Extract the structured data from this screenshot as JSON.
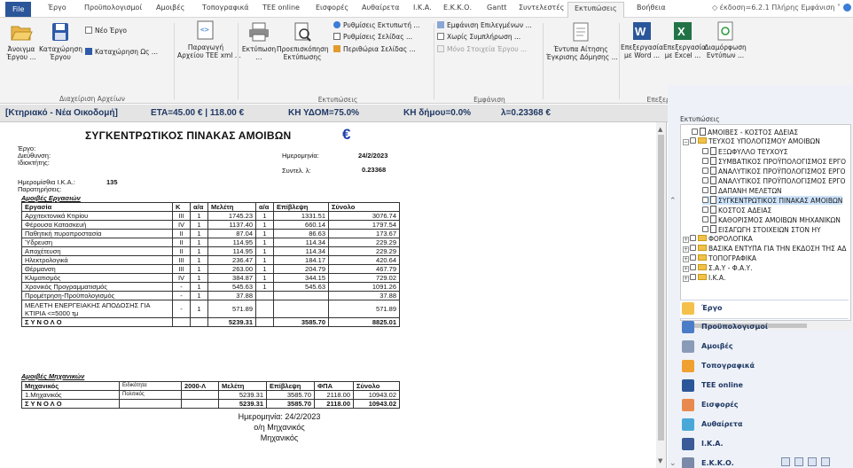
{
  "tabs": {
    "file": "File",
    "items": [
      "Έργο",
      "Προϋπολογισμοί",
      "Αμοιβές",
      "Τοπογραφικά",
      "TEE online",
      "Εισφορές",
      "Αυθαίρετα",
      "Ι.Κ.Α.",
      "Ε.Κ.Κ.Ο.",
      "Gantt",
      "Συντελεστές",
      "Εκτυπώσεις",
      "Βοήθεια"
    ],
    "active": "Εκτυπώσεις"
  },
  "version_info": "◇ έκδοση=6.2.1 Πλήρης  Εμφάνιση  ˅",
  "ribbon": {
    "archive": {
      "open": "Άνοιγμα\nΈργου ...",
      "save": "Καταχώρηση\nΈργου",
      "new": "Νέο Έργο",
      "save_as": "Καταχώρηση Ως ...",
      "group": "Διαχείριση Αρχείων"
    },
    "xml": {
      "label": "Παραγωγή\nΑρχείου TEE xml ..."
    },
    "print": {
      "print": "Εκτύπωση\n...",
      "preview": "Προεπισκόπηση\nΕκτύπωσης",
      "settings1": "Ρυθμίσεις Εκτυπωτή ...",
      "settings2": "Ρυθμίσεις Σελίδας ...",
      "margins": "Περιθώρια Σελίδας ...",
      "group": "Εκτυπώσεις"
    },
    "view": {
      "show_selected": "Εμφάνιση Επιλεγμένων ...",
      "no_fill": "Χωρίς Συμπλήρωση ...",
      "only_project": "Μόνο Στοιχεία Έργου ...",
      "group": "Εμφάνιση"
    },
    "permit": {
      "label": "Έντυπα Αίτησης\nΈγκρισης Δόμησης ..."
    },
    "word": {
      "label": "Επεξεργασία\nμε Word ..."
    },
    "excel": {
      "label": "Επεξεργασία\nμε Excel ..."
    },
    "format": {
      "label": "Διαμόρφωση\nΕντύπων ..."
    },
    "group_edit": "Επεξεργασία Εντύπων"
  },
  "infobar": {
    "project": "[Κτηριακό - Νέα Οικοδομή]",
    "eta": "ΕΤΑ=45.00 € | 118.00 €",
    "kh_ydom": "ΚΗ ΥΔΟΜ=75.0%",
    "kh_dimou": "ΚΗ δήμου=0.0%",
    "lambda": "λ=0.23368 €"
  },
  "doc": {
    "title": "ΣΥΓΚΕΝΤΡΩΤΙΚΟΣ ΠΙΝΑΚΑΣ ΑΜΟΙΒΩΝ",
    "euro": "€",
    "project_label": "Έργο:",
    "address_label": "Διεύθυνση:",
    "owner_label": "Ιδιοκτήτης:",
    "date_label": "Ημερομηνία:",
    "date_value": "24/2/2023",
    "coef_label": "Συντελ. λ:",
    "coef_value": "0.23368",
    "wage_label": "Ημερομίσθια Ι.Κ.Α.:",
    "wage_value": "135",
    "notes_label": "Παρατηρήσεις:",
    "works_title": "Αμοιβές Εργασιών",
    "works_headers": [
      "Εργασία",
      "Κ",
      "α/α",
      "Μελέτη",
      "α/α",
      "Επίβλεψη",
      "Σύνολο"
    ],
    "works_rows": [
      [
        "Αρχιτεκτονικά Κτιρίου",
        "III",
        "1",
        "1745.23",
        "1",
        "1331.51",
        "3076.74"
      ],
      [
        "Φέρουσα Κατασκευή",
        "IV",
        "1",
        "1137.40",
        "1",
        "660.14",
        "1797.54"
      ],
      [
        "Παθητική πυροπροστασία",
        "II",
        "1",
        "87.04",
        "1",
        "86.63",
        "173.67"
      ],
      [
        "Ύδρευση",
        "II",
        "1",
        "114.95",
        "1",
        "114.34",
        "229.29"
      ],
      [
        "Αποχέτευση",
        "II",
        "1",
        "114.95",
        "1",
        "114.34",
        "229.29"
      ],
      [
        "Ηλεκτρολογικά",
        "III",
        "1",
        "236.47",
        "1",
        "184.17",
        "420.64"
      ],
      [
        "Θέρμανση",
        "III",
        "1",
        "263.00",
        "1",
        "204.79",
        "467.79"
      ],
      [
        "Κλιματισμός",
        "IV",
        "1",
        "384.87",
        "1",
        "344.15",
        "729.02"
      ],
      [
        "Χρονικός Προγραμματισμός",
        "-",
        "1",
        "545.63",
        "1",
        "545.63",
        "1091.26"
      ],
      [
        "Προμέτρηση-Προϋπολογισμός",
        "-",
        "1",
        "37.88",
        "",
        "",
        "37.88"
      ],
      [
        "ΜΕΛΕΤΗ ΕΝΕΡΓΕΙΑΚΗΣ ΑΠΟΔΟΣΗΣ ΓΙΑ ΚΤΙΡΙΑ <=5000 τμ",
        "-",
        "1",
        "571.89",
        "",
        "",
        "571.89"
      ]
    ],
    "works_total": [
      "Σ Υ Ν Ο Λ Ο",
      "",
      "",
      "5239.31",
      "",
      "3585.70",
      "8825.01"
    ],
    "eng_title": "Αμοιβές Μηχανικών",
    "eng_headers": [
      "Μηχανικός",
      "Ειδικότητα",
      "2000-Λ",
      "Μελέτη",
      "Επίβλεψη",
      "ΦΠΑ",
      "Σύνολο"
    ],
    "eng_rows": [
      [
        "1.Μηχανικός",
        "Πολιτικός",
        "",
        "5239.31",
        "3585.70",
        "2118.00",
        "10943.02"
      ]
    ],
    "eng_total": [
      "Σ Υ Ν Ο Λ Ο",
      "",
      "",
      "5239.31",
      "3585.70",
      "2118.00",
      "10943.02"
    ],
    "sign_date": "Ημερομηνία: 24/2/2023",
    "sign_role": "ο/η Μηχανικός",
    "sign_name": "Μηχανικός"
  },
  "panel": {
    "header": "Εκτυπώσεις",
    "tree": [
      {
        "label": "ΑΜΟΙΒΕΣ - ΚΟΣΤΟΣ ΑΔΕΙΑΣ",
        "type": "page",
        "level": 1
      },
      {
        "label": "ΤΕΥΧΟΣ ΥΠΟΛΟΓΙΣΜΟΥ ΑΜΟΙΒΩΝ",
        "type": "folder-open",
        "level": 0
      },
      {
        "label": "ΕΞΩΦΥΛΛΟ ΤΕΥΧΟΥΣ",
        "type": "page",
        "level": 2
      },
      {
        "label": "ΣΥΜΒΑΤΙΚΟΣ ΠΡΟΫΠΟΛΟΓΙΣΜΟΣ ΕΡΓΟ",
        "type": "page",
        "level": 2
      },
      {
        "label": "ΑΝΑΛΥΤΙΚΟΣ ΠΡΟΫΠΟΛΟΓΙΣΜΟΣ ΕΡΓΟ",
        "type": "page",
        "level": 2
      },
      {
        "label": "ΑΝΑΛΥΤΙΚΟΣ ΠΡΟΫΠΟΛΟΓΙΣΜΟΣ ΕΡΓΟ",
        "type": "page",
        "level": 2
      },
      {
        "label": "ΔΑΠΑΝΗ ΜΕΛΕΤΩΝ",
        "type": "page",
        "level": 2
      },
      {
        "label": "ΣΥΓΚΕΝΤΡΩΤΙΚΟΣ ΠΙΝΑΚΑΣ ΑΜΟΙΒΩΝ",
        "type": "page",
        "level": 2,
        "selected": true
      },
      {
        "label": "ΚΟΣΤΟΣ ΑΔΕΙΑΣ",
        "type": "page",
        "level": 2
      },
      {
        "label": "ΚΑΘΟΡΙΣΜΟΣ ΑΜΟΙΒΩΝ ΜΗΧΑΝΙΚΩΝ",
        "type": "page",
        "level": 2
      },
      {
        "label": "ΕΙΣΑΓΩΓΗ ΣΤΟΙΧΕΙΩΝ ΣΤΟΝ ΗΥ",
        "type": "page",
        "level": 2
      },
      {
        "label": "ΦΟΡΟΛΟΓΙΚΑ",
        "type": "folder",
        "level": 0
      },
      {
        "label": "ΒΑΣΙΚΑ ΕΝΤΥΠΑ ΓΙΑ ΤΗΝ ΕΚΔΟΣΗ ΤΗΣ ΑΔ",
        "type": "folder",
        "level": 0
      },
      {
        "label": "ΤΟΠΟΓΡΑΦΙΚΑ",
        "type": "folder",
        "level": 0
      },
      {
        "label": "Σ.Α.Υ - Φ.Α.Υ.",
        "type": "folder",
        "level": 0
      },
      {
        "label": "Ι.Κ.Α.",
        "type": "folder",
        "level": 0
      }
    ],
    "nav": [
      "Έργο",
      "Προϋπολογισμοί",
      "Αμοιβές",
      "Τοπογραφικά",
      "TEE online",
      "Εισφορές",
      "Αυθαίρετα",
      "Ι.Κ.Α.",
      "Ε.Κ.Κ.Ο."
    ]
  },
  "colors": {
    "file_tab": "#2b579a",
    "infobar_text": "#1f3864",
    "euro": "#1b3fa8",
    "selected": "#cde3fb"
  }
}
